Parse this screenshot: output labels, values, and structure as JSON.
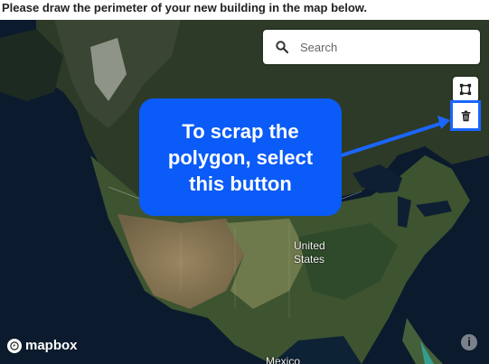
{
  "instruction": "Please draw the perimeter of your new building in the map below.",
  "search": {
    "placeholder": "Search"
  },
  "draw_controls": {
    "polygon_tool": {
      "icon": "polygon-icon"
    },
    "trash_tool": {
      "icon": "trash-icon",
      "highlight_color": "#1a66ff"
    }
  },
  "callout": {
    "text": "To scrap the polygon, select this button",
    "line1": "To scrap the",
    "line2": "polygon, select",
    "line3": "this button",
    "background_color": "#0a5bf7"
  },
  "map": {
    "labels": {
      "country1_line1": "United",
      "country1_line2": "States",
      "country2": "Mexico"
    },
    "attribution": "mapbox",
    "info_glyph": "i"
  },
  "colors": {
    "ocean": "#0b1a2c",
    "land_dark": "#2f3a23",
    "land_green": "#3e5330",
    "land_tan": "#8e7a58",
    "water_lake": "#0e1f33",
    "accent": "#1a66ff"
  }
}
